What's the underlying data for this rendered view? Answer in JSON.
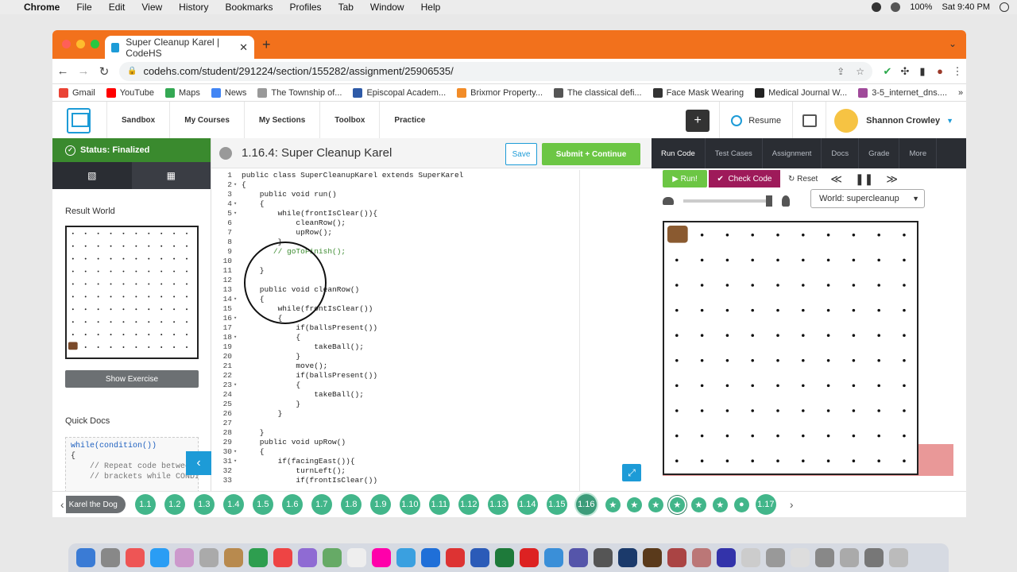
{
  "menubar": {
    "app": "Chrome",
    "items": [
      "File",
      "Edit",
      "View",
      "History",
      "Bookmarks",
      "Profiles",
      "Tab",
      "Window",
      "Help"
    ],
    "battery": "100%",
    "clock": "Sat 9:40 PM"
  },
  "browser": {
    "tab_title": "Super Cleanup Karel | CodeHS",
    "url": "codehs.com/student/291224/section/155282/assignment/25906535/",
    "bookmarks": [
      {
        "label": "Gmail",
        "color": "#ea4335"
      },
      {
        "label": "YouTube",
        "color": "#ff0000"
      },
      {
        "label": "Maps",
        "color": "#34a853"
      },
      {
        "label": "News",
        "color": "#4285f4"
      },
      {
        "label": "The Township of...",
        "color": "#999999"
      },
      {
        "label": "Episcopal Academ...",
        "color": "#2e5aa7"
      },
      {
        "label": "Brixmor Property...",
        "color": "#f28c28"
      },
      {
        "label": "The classical defi...",
        "color": "#555555"
      },
      {
        "label": "Face Mask Wearing",
        "color": "#333333"
      },
      {
        "label": "Medical Journal W...",
        "color": "#222222"
      },
      {
        "label": "3-5_internet_dns....",
        "color": "#a04a9a"
      }
    ]
  },
  "site_nav": {
    "links": [
      "Sandbox",
      "My Courses",
      "My Sections",
      "Toolbox",
      "Practice"
    ],
    "resume": "Resume",
    "user": "Shannon Crowley"
  },
  "left_panel": {
    "status": "Status: Finalized",
    "result_world": "Result World",
    "show_exercise": "Show Exercise",
    "quick_docs": "Quick Docs",
    "docs_code": [
      {
        "cls": "kw",
        "text": "while(condition())"
      },
      {
        "cls": "",
        "text": "{"
      },
      {
        "cls": "cm",
        "text": "    // Repeat code between"
      },
      {
        "cls": "cm",
        "text": "    // brackets while CONDIT"
      }
    ]
  },
  "editor": {
    "title": "1.16.4: Super Cleanup Karel",
    "save": "Save",
    "submit": "Submit + Continue",
    "lines": [
      {
        "n": "1",
        "f": "",
        "t": "public class SuperCleanupKarel extends SuperKarel"
      },
      {
        "n": "2",
        "f": "▾",
        "t": "{"
      },
      {
        "n": "3",
        "f": "",
        "t": "    public void run()"
      },
      {
        "n": "4",
        "f": "▾",
        "t": "    {"
      },
      {
        "n": "5",
        "f": "▾",
        "t": "        while(frontIsClear()){"
      },
      {
        "n": "6",
        "f": "",
        "t": "            cleanRow();"
      },
      {
        "n": "7",
        "f": "",
        "t": "            upRow();"
      },
      {
        "n": "8",
        "f": "",
        "t": "        }"
      },
      {
        "n": "9",
        "f": "",
        "t": "       // goToFinish();"
      },
      {
        "n": "10",
        "f": "",
        "t": ""
      },
      {
        "n": "11",
        "f": "",
        "t": "    }"
      },
      {
        "n": "12",
        "f": "",
        "t": ""
      },
      {
        "n": "13",
        "f": "",
        "t": "    public void cleanRow()"
      },
      {
        "n": "14",
        "f": "▾",
        "t": "    {"
      },
      {
        "n": "15",
        "f": "",
        "t": "        while(frontIsClear())"
      },
      {
        "n": "16",
        "f": "▾",
        "t": "        {"
      },
      {
        "n": "17",
        "f": "",
        "t": "            if(ballsPresent())"
      },
      {
        "n": "18",
        "f": "▾",
        "t": "            {"
      },
      {
        "n": "19",
        "f": "",
        "t": "                takeBall();"
      },
      {
        "n": "20",
        "f": "",
        "t": "            }"
      },
      {
        "n": "21",
        "f": "",
        "t": "            move();"
      },
      {
        "n": "22",
        "f": "",
        "t": "            if(ballsPresent())"
      },
      {
        "n": "23",
        "f": "▾",
        "t": "            {"
      },
      {
        "n": "24",
        "f": "",
        "t": "                takeBall();"
      },
      {
        "n": "25",
        "f": "",
        "t": "            }"
      },
      {
        "n": "26",
        "f": "",
        "t": "        }"
      },
      {
        "n": "27",
        "f": "",
        "t": ""
      },
      {
        "n": "28",
        "f": "",
        "t": "    }"
      },
      {
        "n": "29",
        "f": "",
        "t": "    public void upRow()"
      },
      {
        "n": "30",
        "f": "▾",
        "t": "    {"
      },
      {
        "n": "31",
        "f": "▾",
        "t": "        if(facingEast()){"
      },
      {
        "n": "32",
        "f": "",
        "t": "            turnLeft();"
      },
      {
        "n": "33",
        "f": "",
        "t": "            if(frontIsClear())"
      }
    ]
  },
  "run_panel": {
    "tabs": [
      "Run Code",
      "Test Cases",
      "Assignment",
      "Docs",
      "Grade",
      "More"
    ],
    "run": "Run!",
    "check": "Check Code",
    "reset": "Reset",
    "world_select": "World: supercleanup"
  },
  "progress": {
    "unit": "Karel the Dog",
    "before": [
      "1.1",
      "1.2",
      "1.3",
      "1.4",
      "1.5",
      "1.6",
      "1.7",
      "1.8",
      "1.9",
      "1.10",
      "1.11",
      "1.12",
      "1.13",
      "1.14",
      "1.15",
      "1.16"
    ],
    "after": "1.17"
  }
}
